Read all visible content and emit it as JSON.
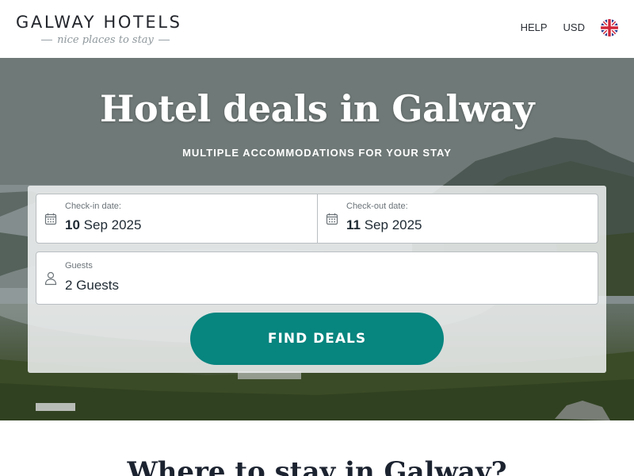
{
  "header": {
    "logo_main": "GALWAY HOTELS",
    "logo_tagline": "nice places to stay",
    "nav": {
      "help": "HELP",
      "currency": "USD",
      "language_flag": "uk-flag-icon"
    }
  },
  "hero": {
    "title": "Hotel deals in Galway",
    "subtitle": "MULTIPLE ACCOMMODATIONS FOR YOUR STAY"
  },
  "search": {
    "checkin": {
      "label": "Check-in date:",
      "day": "10",
      "month_year": "Sep 2025",
      "icon": "calendar-icon"
    },
    "checkout": {
      "label": "Check-out date:",
      "day": "11",
      "month_year": "Sep 2025",
      "icon": "calendar-icon"
    },
    "guests": {
      "label": "Guests",
      "value": "2 Guests",
      "icon": "person-icon"
    },
    "button_label": "FIND DEALS"
  },
  "section": {
    "title": "Where to stay in Galway?"
  },
  "colors": {
    "accent": "#07857f",
    "text_dark": "#1f2a33",
    "hero_text": "#ffffff"
  }
}
